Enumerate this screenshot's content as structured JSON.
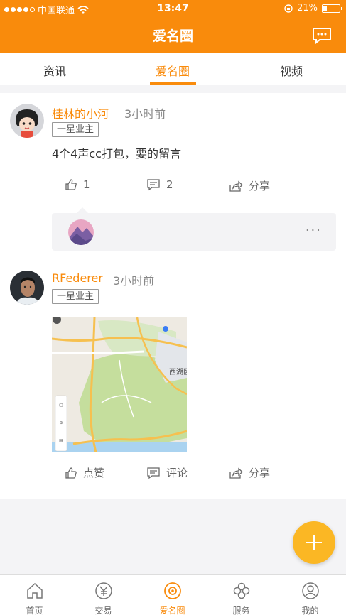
{
  "status_bar": {
    "carrier": "中国联通",
    "time": "13:47",
    "battery": "21%"
  },
  "nav": {
    "title": "爱名圈",
    "message_icon": "chat-bubble-icon"
  },
  "tabs": [
    {
      "label": "资讯",
      "active": false
    },
    {
      "label": "爱名圈",
      "active": true
    },
    {
      "label": "视频",
      "active": false
    }
  ],
  "posts": [
    {
      "username": "桂林的小河",
      "time": "3小时前",
      "badge": "一星业主",
      "text": "4个4声cc打包，要的留言",
      "likes": "1",
      "comments": "2",
      "share_label": "分享"
    },
    {
      "username": "RFederer",
      "time": "3小时前",
      "badge": "一星业主",
      "like_label": "点赞",
      "comment_label": "评论",
      "share_label": "分享",
      "map_labels": {
        "west_lake": "西湖区"
      }
    }
  ],
  "fab": {
    "icon": "plus-icon"
  },
  "tabbar": [
    {
      "label": "首页",
      "icon": "home-icon"
    },
    {
      "label": "交易",
      "icon": "yuan-icon"
    },
    {
      "label": "爱名圈",
      "icon": "circle-icon",
      "active": true
    },
    {
      "label": "服务",
      "icon": "clover-icon"
    },
    {
      "label": "我的",
      "icon": "user-icon"
    }
  ],
  "colors": {
    "accent": "#f98b0c",
    "fab": "#fbb724"
  }
}
